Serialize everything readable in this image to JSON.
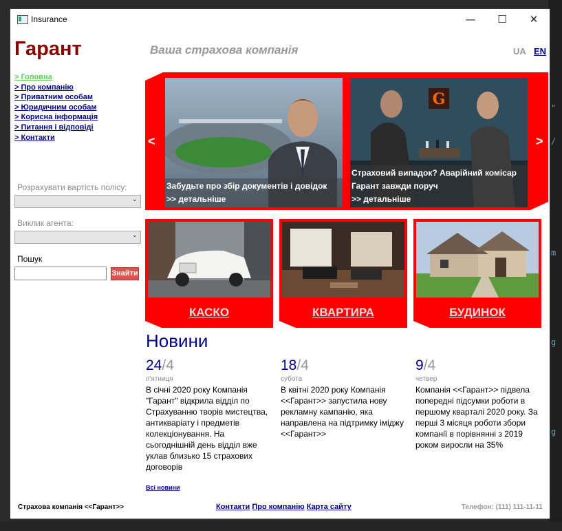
{
  "window": {
    "title": "Insurance",
    "minimize": "—",
    "maximize": "☐",
    "close": "✕"
  },
  "header": {
    "brand": "Гарант",
    "tagline": "Ваша страхова компанія",
    "lang_ua": "UA",
    "lang_en": "EN"
  },
  "nav": [
    "> Головна",
    "> Про компанію",
    "> Приватним особам",
    "> Юридичним особам",
    "> Корисна інформація",
    "> Питання і відповіді",
    "> Контакти"
  ],
  "sidebar": {
    "calc_label": "Розрахувати вартість полісу:",
    "agent_label": "Виклик агента:",
    "search_label": "Пошук",
    "search_value": "",
    "search_button": "Знайти"
  },
  "slider": {
    "prev": "<",
    "next": ">",
    "slides": [
      {
        "line1": "Забудьте про збір документів і довідок",
        "line2": ">> детальніше"
      },
      {
        "line1": "Страховий випадок? Аварійний комісар",
        "line2": "Гарант завжди поруч",
        "line3": ">> детальніше"
      }
    ]
  },
  "cards": [
    "КАСКО",
    "КВАРТИРА",
    "БУДИНОК"
  ],
  "news": {
    "heading": "Новини",
    "items": [
      {
        "day": "24",
        "month": "/4",
        "weekday": "п'ятниця",
        "text": "В січні 2020 року Компанія \"Гарант\" відкрила відділ по Страхуванню творів мистецтва, антикваріату і предметів колекціонування. На сьогоднішній день відділ вже уклав близько 15 страхових договорів"
      },
      {
        "day": "18",
        "month": "/4",
        "weekday": "субота",
        "text": "В квітні 2020 року Компанія <<Гарант>> запустила нову рекламну кампанію, яка направлена на підтримку іміджу <<Гарант>>"
      },
      {
        "day": "9",
        "month": "/4",
        "weekday": "четвер",
        "text": "Компанія <<Гарант>> підвела попередні підсумки роботи в першому кварталі 2020 року. За перші 3 місяця роботи збори компанії в порівнянні з 2019 роком виросли на 35%"
      }
    ],
    "all_news": "Всі новини"
  },
  "footer": {
    "company": "Страхова компанія <<Гарант>>",
    "contacts": "Контакти",
    "about": "Про компанію",
    "sitemap": "Карта сайту",
    "phone": "Телефон: (111) 111-11-11"
  },
  "colors": {
    "accent": "#ff0000",
    "brand": "#8b0000",
    "link": "#00008b"
  }
}
